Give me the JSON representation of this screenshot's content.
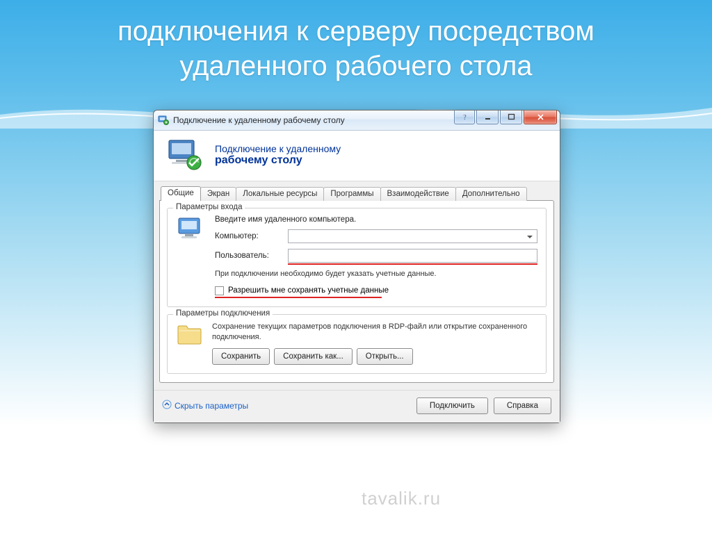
{
  "slide": {
    "title": "подключения к серверу посредством удаленного рабочего стола"
  },
  "window": {
    "title": "Подключение к удаленному рабочему столу",
    "banner": {
      "line1": "Подключение к удаленному",
      "line2": "рабочему столу"
    },
    "tabs": [
      {
        "label": "Общие",
        "active": true
      },
      {
        "label": "Экран"
      },
      {
        "label": "Локальные ресурсы"
      },
      {
        "label": "Программы"
      },
      {
        "label": "Взаимодействие"
      },
      {
        "label": "Дополнительно"
      }
    ],
    "login_group": {
      "title": "Параметры входа",
      "hint": "Введите имя удаленного компьютера.",
      "computer_label": "Компьютер:",
      "computer_value": "",
      "user_label": "Пользователь:",
      "user_value": "",
      "note": "При подключении необходимо будет указать учетные данные.",
      "save_creds_label": "Разрешить мне сохранять учетные данные"
    },
    "conn_group": {
      "title": "Параметры подключения",
      "text": "Сохранение текущих параметров подключения в RDP-файл или открытие сохраненного подключения.",
      "save": "Сохранить",
      "save_as": "Сохранить как...",
      "open": "Открыть..."
    },
    "footer": {
      "hide": "Скрыть параметры",
      "connect": "Подключить",
      "help": "Справка"
    }
  },
  "watermark": "tavalik.ru"
}
